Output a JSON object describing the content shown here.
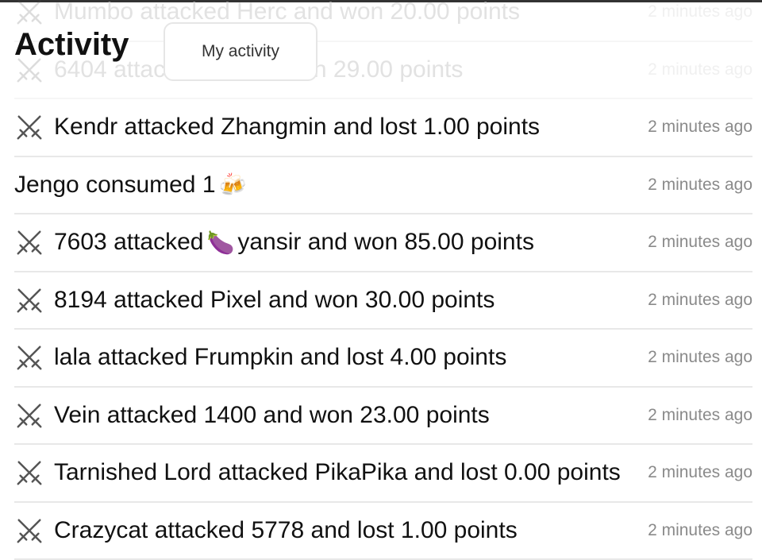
{
  "header": {
    "title": "Activity",
    "my_activity_label": "My activity"
  },
  "activities": [
    {
      "text": "Mumbo attacked Herc and won 20.00 points",
      "time": "2 minutes ago",
      "icon": "crossed-swords-icon",
      "faded": true
    },
    {
      "text": "6404 attacked ... and won 29.00 points",
      "time": "2 minutes ago",
      "icon": "crossed-swords-icon",
      "faded": true
    },
    {
      "text": "Kendr attacked Zhangmin and lost 1.00 points",
      "time": "2 minutes ago",
      "icon": "crossed-swords-icon"
    },
    {
      "text": "Jengo consumed 1",
      "time": "2 minutes ago",
      "icon": "none",
      "trailing_emoji": "🍻"
    },
    {
      "text_before": "7603 attacked",
      "emoji": "🍆",
      "text_after": "yansir and won 85.00 points",
      "time": "2 minutes ago",
      "icon": "crossed-swords-icon"
    },
    {
      "text": "8194 attacked Pixel and won 30.00 points",
      "time": "2 minutes ago",
      "icon": "crossed-swords-icon"
    },
    {
      "text": "lala attacked Frumpkin and lost 4.00 points",
      "time": "2 minutes ago",
      "icon": "crossed-swords-icon"
    },
    {
      "text": "Vein attacked 1400 and won 23.00 points",
      "time": "2 minutes ago",
      "icon": "crossed-swords-icon"
    },
    {
      "text": "Tarnished Lord attacked PikaPika and lost 0.00 points",
      "time": "2 minutes ago",
      "icon": "crossed-swords-icon"
    },
    {
      "text": "Crazycat attacked 5778 and lost 1.00 points",
      "time": "2 minutes ago",
      "icon": "crossed-swords-icon"
    }
  ]
}
